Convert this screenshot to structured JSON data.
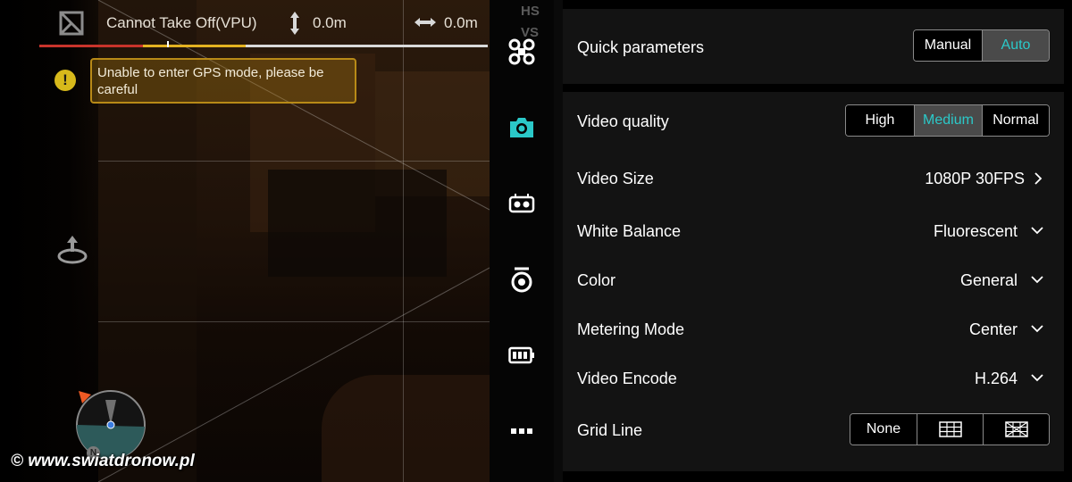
{
  "status_bar": {
    "takeoff_warning": "Cannot Take Off(VPU)",
    "altitude": "0.0m",
    "distance": "0.0m",
    "hs_label": "HS",
    "vs_label": "VS"
  },
  "gps_warning": "Unable to enter GPS mode, please be careful",
  "compass_north": "N",
  "watermark": "© www.swiatdronow.pl",
  "rail": {
    "items": [
      "drone-icon",
      "camera-icon",
      "gimbal-icon",
      "remote-controller-icon",
      "battery-icon",
      "more-icon"
    ],
    "active": "camera-icon",
    "accent_color": "#2bc9c9"
  },
  "settings": {
    "quick_parameters": {
      "label": "Quick parameters",
      "options": [
        "Manual",
        "Auto"
      ],
      "selected": "Auto"
    },
    "video_quality": {
      "label": "Video quality",
      "options": [
        "High",
        "Medium",
        "Normal"
      ],
      "selected": "Medium"
    },
    "video_size": {
      "label": "Video Size",
      "value": "1080P 30FPS"
    },
    "white_balance": {
      "label": "White Balance",
      "value": "Fluorescent"
    },
    "color": {
      "label": "Color",
      "value": "General"
    },
    "metering_mode": {
      "label": "Metering Mode",
      "value": "Center"
    },
    "video_encode": {
      "label": "Video Encode",
      "value": "H.264"
    },
    "grid_line": {
      "label": "Grid Line",
      "options": [
        "None",
        "grid-icon",
        "grid-diagonal-icon"
      ],
      "selected": "None"
    }
  }
}
